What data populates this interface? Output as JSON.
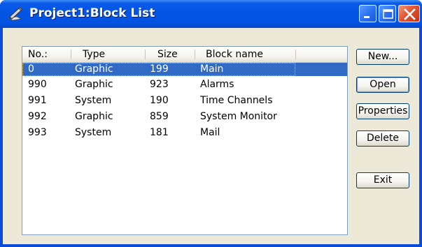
{
  "window": {
    "title": "Project1:Block List"
  },
  "list": {
    "columns": [
      "No.:",
      "Type",
      "Size",
      "Block name"
    ],
    "rows": [
      {
        "no": "0",
        "type": "Graphic",
        "size": "199",
        "name": "Main",
        "selected": true
      },
      {
        "no": "990",
        "type": "Graphic",
        "size": "923",
        "name": "Alarms",
        "selected": false
      },
      {
        "no": "991",
        "type": "System",
        "size": "190",
        "name": "Time Channels",
        "selected": false
      },
      {
        "no": "992",
        "type": "Graphic",
        "size": "859",
        "name": "System Monitor",
        "selected": false
      },
      {
        "no": "993",
        "type": "System",
        "size": "181",
        "name": "Mail",
        "selected": false
      }
    ]
  },
  "buttons": {
    "new": "New...",
    "open": "Open",
    "properties": "Properties",
    "delete": "Delete",
    "exit": "Exit"
  },
  "colors": {
    "titlebar": "#0454e4",
    "selection": "#316ac5",
    "dialog": "#ece9d8",
    "close_button": "#e0502a"
  },
  "icons": {
    "title": "pencil-paper-icon",
    "minimize": "minimize-icon",
    "maximize": "maximize-icon",
    "close": "close-icon"
  }
}
